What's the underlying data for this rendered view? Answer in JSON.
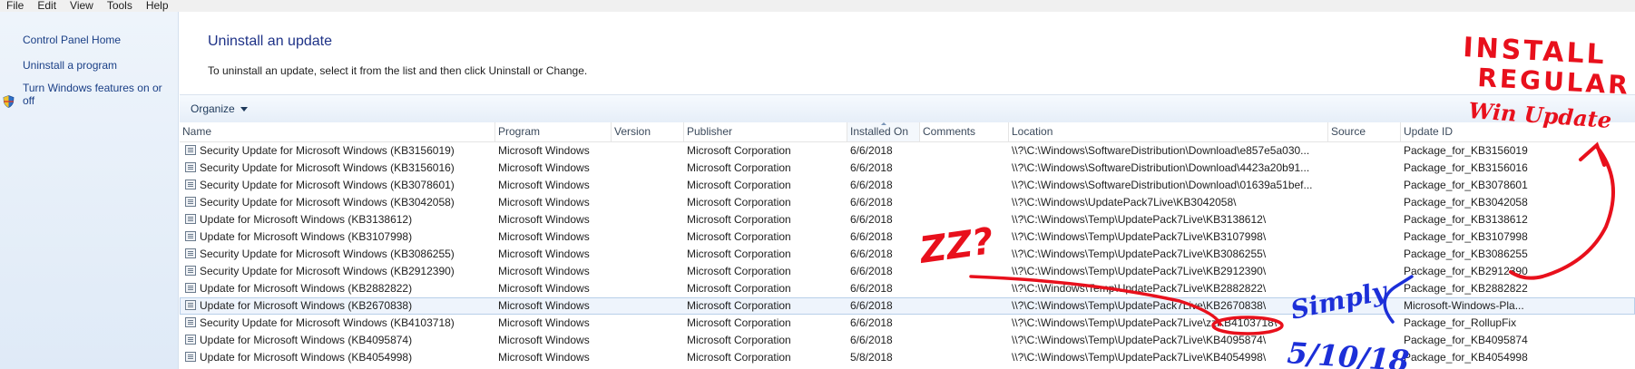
{
  "menu": [
    "File",
    "Edit",
    "View",
    "Tools",
    "Help"
  ],
  "sidebar": {
    "home": "Control Panel Home",
    "uninstall_program": "Uninstall a program",
    "windows_features": [
      "Turn Windows features on or",
      "off"
    ]
  },
  "main": {
    "title": "Uninstall an update",
    "description": "To uninstall an update, select it from the list and then click Uninstall or Change."
  },
  "toolbar": {
    "organize": "Organize"
  },
  "columns": [
    "Name",
    "Program",
    "Version",
    "Publisher",
    "Installed On",
    "Comments",
    "Location",
    "Source",
    "Update ID"
  ],
  "rows": [
    {
      "name": "Security Update for Microsoft Windows (KB3156019)",
      "program": "Microsoft Windows",
      "version": "",
      "publisher": "Microsoft Corporation",
      "installed": "6/6/2018",
      "comments": "",
      "location": "\\\\?\\C:\\Windows\\SoftwareDistribution\\Download\\e857e5a030...",
      "source": "",
      "update_id": "Package_for_KB3156019"
    },
    {
      "name": "Security Update for Microsoft Windows (KB3156016)",
      "program": "Microsoft Windows",
      "version": "",
      "publisher": "Microsoft Corporation",
      "installed": "6/6/2018",
      "comments": "",
      "location": "\\\\?\\C:\\Windows\\SoftwareDistribution\\Download\\4423a20b91...",
      "source": "",
      "update_id": "Package_for_KB3156016"
    },
    {
      "name": "Security Update for Microsoft Windows (KB3078601)",
      "program": "Microsoft Windows",
      "version": "",
      "publisher": "Microsoft Corporation",
      "installed": "6/6/2018",
      "comments": "",
      "location": "\\\\?\\C:\\Windows\\SoftwareDistribution\\Download\\01639a51bef...",
      "source": "",
      "update_id": "Package_for_KB3078601"
    },
    {
      "name": "Security Update for Microsoft Windows (KB3042058)",
      "program": "Microsoft Windows",
      "version": "",
      "publisher": "Microsoft Corporation",
      "installed": "6/6/2018",
      "comments": "",
      "location": "\\\\?\\C:\\Windows\\UpdatePack7Live\\KB3042058\\",
      "source": "",
      "update_id": "Package_for_KB3042058"
    },
    {
      "name": "Update for Microsoft Windows (KB3138612)",
      "program": "Microsoft Windows",
      "version": "",
      "publisher": "Microsoft Corporation",
      "installed": "6/6/2018",
      "comments": "",
      "location": "\\\\?\\C:\\Windows\\Temp\\UpdatePack7Live\\KB3138612\\",
      "source": "",
      "update_id": "Package_for_KB3138612"
    },
    {
      "name": "Update for Microsoft Windows (KB3107998)",
      "program": "Microsoft Windows",
      "version": "",
      "publisher": "Microsoft Corporation",
      "installed": "6/6/2018",
      "comments": "",
      "location": "\\\\?\\C:\\Windows\\Temp\\UpdatePack7Live\\KB3107998\\",
      "source": "",
      "update_id": "Package_for_KB3107998"
    },
    {
      "name": "Security Update for Microsoft Windows (KB3086255)",
      "program": "Microsoft Windows",
      "version": "",
      "publisher": "Microsoft Corporation",
      "installed": "6/6/2018",
      "comments": "",
      "location": "\\\\?\\C:\\Windows\\Temp\\UpdatePack7Live\\KB3086255\\",
      "source": "",
      "update_id": "Package_for_KB3086255"
    },
    {
      "name": "Security Update for Microsoft Windows (KB2912390)",
      "program": "Microsoft Windows",
      "version": "",
      "publisher": "Microsoft Corporation",
      "installed": "6/6/2018",
      "comments": "",
      "location": "\\\\?\\C:\\Windows\\Temp\\UpdatePack7Live\\KB2912390\\",
      "source": "",
      "update_id": "Package_for_KB2912390"
    },
    {
      "name": "Update for Microsoft Windows (KB2882822)",
      "program": "Microsoft Windows",
      "version": "",
      "publisher": "Microsoft Corporation",
      "installed": "6/6/2018",
      "comments": "",
      "location": "\\\\?\\C:\\Windows\\Temp\\UpdatePack7Live\\KB2882822\\",
      "source": "",
      "update_id": "Package_for_KB2882822"
    },
    {
      "name": "Update for Microsoft Windows (KB2670838)",
      "program": "Microsoft Windows",
      "version": "",
      "publisher": "Microsoft Corporation",
      "installed": "6/6/2018",
      "comments": "",
      "location": "\\\\?\\C:\\Windows\\Temp\\UpdatePack7Live\\KB2670838\\",
      "source": "",
      "update_id": "Microsoft-Windows-Pla..."
    },
    {
      "name": "Security Update for Microsoft Windows (KB4103718)",
      "program": "Microsoft Windows",
      "version": "",
      "publisher": "Microsoft Corporation",
      "installed": "6/6/2018",
      "comments": "",
      "location": "\\\\?\\C:\\Windows\\Temp\\UpdatePack7Live\\zzKB4103718\\",
      "source": "",
      "update_id": "Package_for_RollupFix"
    },
    {
      "name": "Update for Microsoft Windows (KB4095874)",
      "program": "Microsoft Windows",
      "version": "",
      "publisher": "Microsoft Corporation",
      "installed": "6/6/2018",
      "comments": "",
      "location": "\\\\?\\C:\\Windows\\Temp\\UpdatePack7Live\\KB4095874\\",
      "source": "",
      "update_id": "Package_for_KB4095874"
    },
    {
      "name": "Update for Microsoft Windows (KB4054998)",
      "program": "Microsoft Windows",
      "version": "",
      "publisher": "Microsoft Corporation",
      "installed": "5/8/2018",
      "comments": "",
      "location": "\\\\?\\C:\\Windows\\Temp\\UpdatePack7Live\\KB4054998\\",
      "source": "",
      "update_id": "Package_for_KB4054998"
    }
  ],
  "selected_row": 9,
  "annotations": {
    "install_note": [
      "INSTALL",
      "REGULAR",
      "Win Update"
    ],
    "zz_note": "ZZ?",
    "simply_note": [
      "Simply",
      "5/10/18"
    ],
    "ink_color": "#e8101c",
    "ink_color_blue": "#1c2fd8"
  },
  "colors": {
    "link": "#1a3f86",
    "title": "#1e3287",
    "sidebar_bg": "#eef4fb"
  }
}
